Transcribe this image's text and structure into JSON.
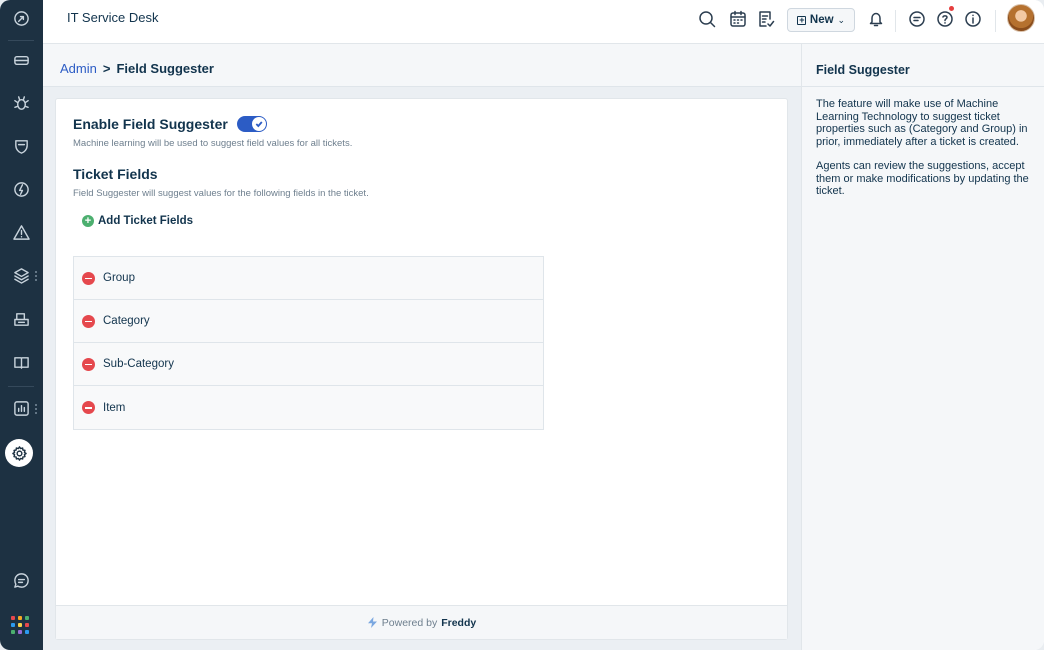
{
  "header": {
    "app_title": "IT Service Desk",
    "new_label": "New"
  },
  "breadcrumb": {
    "parent": "Admin",
    "separator": ">",
    "current": "Field Suggester"
  },
  "main": {
    "enable_title": "Enable Field Suggester",
    "enable_toggle_on": true,
    "enable_hint": "Machine learning will be used to suggest field values for all tickets.",
    "ticket_fields_title": "Ticket Fields",
    "ticket_fields_hint": "Field Suggester will suggest values for the following fields in the ticket.",
    "add_fields_label": "Add Ticket Fields",
    "fields": [
      "Group",
      "Category",
      "Sub-Category",
      "Item"
    ]
  },
  "footer": {
    "powered_by": "Powered by",
    "brand": "Freddy"
  },
  "right_panel": {
    "title": "Field Suggester",
    "paragraph_1": "The feature will make use of Machine Learning Technology to suggest ticket properties such as (Category and Group) in prior, immediately after a ticket is created.",
    "paragraph_2": "Agents can review the suggestions, accept them or make modifications by updating the ticket."
  },
  "colors": {
    "sidebar": "#1d3142",
    "accent": "#2c5cc5",
    "add": "#4caf6f",
    "remove": "#e5484d",
    "notification": "#e53e3e"
  },
  "icons": {
    "sidebar": [
      "dashboard-icon",
      "tickets-icon",
      "problems-icon",
      "changes-icon",
      "releases-icon",
      "alerts-icon",
      "assets-icon",
      "purchase-icon",
      "solutions-icon",
      "analytics-icon",
      "admin-gear-icon",
      "chat-icon",
      "apps-grid-icon"
    ],
    "header": [
      "search-icon",
      "calendar-icon",
      "notes-icon",
      "bell-icon",
      "chat-icon",
      "help-icon",
      "info-icon"
    ]
  }
}
